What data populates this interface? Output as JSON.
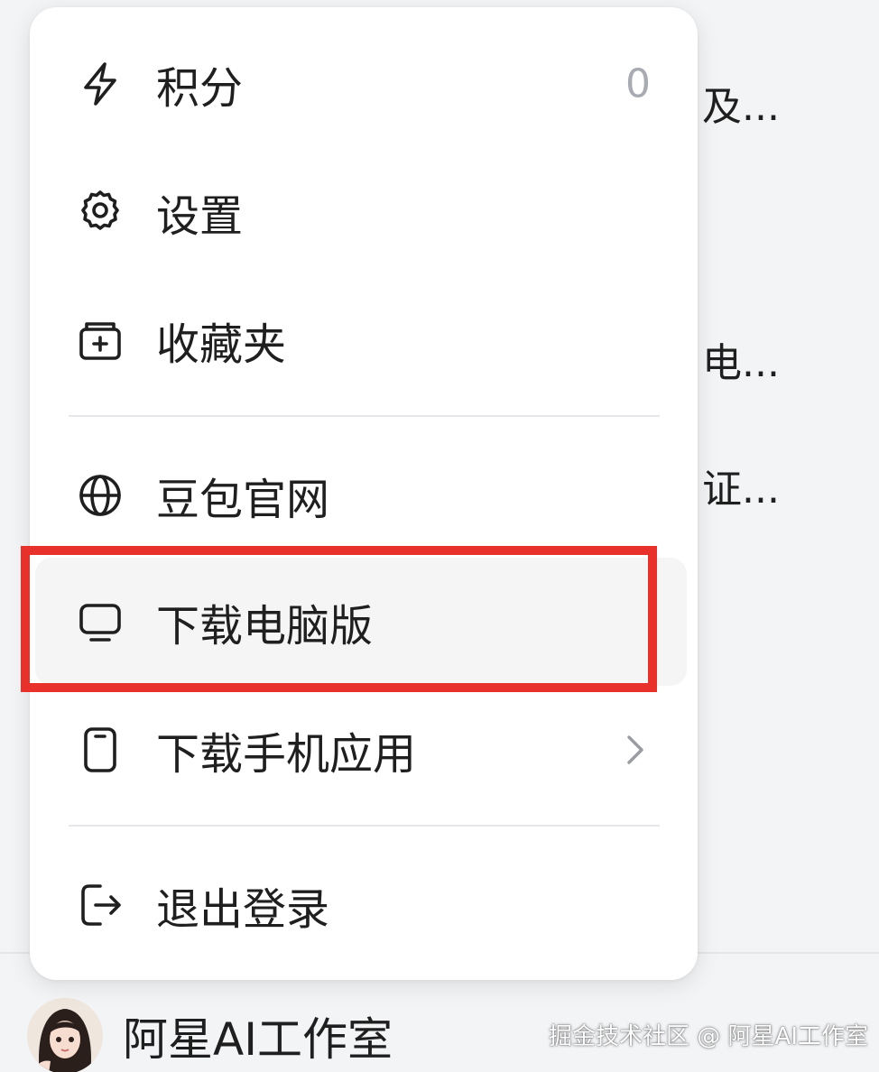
{
  "background_list": [
    "及...",
    "电...",
    "证..."
  ],
  "menu": {
    "items": [
      {
        "label": "积分",
        "icon": "lightning-icon",
        "value": "0"
      },
      {
        "label": "设置",
        "icon": "gear-icon"
      },
      {
        "label": "收藏夹",
        "icon": "collection-folder-icon"
      },
      {
        "label": "豆包官网",
        "icon": "globe-icon"
      },
      {
        "label": "下载电脑版",
        "icon": "monitor-icon"
      },
      {
        "label": "下载手机应用",
        "icon": "phone-icon",
        "chevron": "chevron-right-icon"
      },
      {
        "label": "退出登录",
        "icon": "logout-icon"
      }
    ]
  },
  "highlight": {
    "target": "下载电脑版",
    "color": "#e8312a"
  },
  "footer": {
    "username": "阿星AI工作室",
    "avatar": "avatar-image",
    "watermark": "掘金技术社区 @ 阿星AI工作室"
  }
}
